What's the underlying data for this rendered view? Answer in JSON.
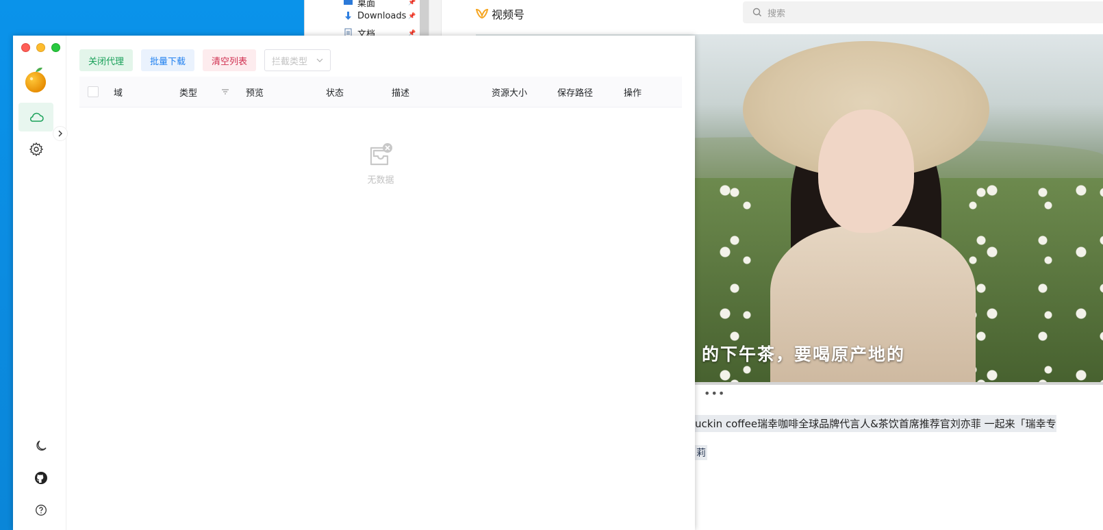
{
  "explorer": {
    "items": [
      {
        "label": "桌面",
        "icon": "desktop-icon"
      },
      {
        "label": "Downloads",
        "icon": "download-arrow-icon"
      },
      {
        "label": "文档",
        "icon": "document-icon"
      }
    ],
    "pin_glyph": "📌"
  },
  "channels": {
    "app_name": "视频号",
    "search_placeholder": "搜索",
    "video_caption": "的下午茶，要喝原产地的",
    "more": "•••",
    "description": "uckin coffee瑞幸咖啡全球品牌代言人&茶饮首席推荐官刘亦菲 一起来「瑞幸专",
    "tag": "莉"
  },
  "app": {
    "toolbar": {
      "close_proxy": "关闭代理",
      "batch_download": "批量下载",
      "clear_list": "清空列表",
      "intercept_type_placeholder": "拦截类型"
    },
    "table": {
      "columns": [
        "域",
        "类型",
        "预览",
        "状态",
        "描述",
        "资源大小",
        "保存路径",
        "操作"
      ],
      "rows": [],
      "empty_text": "无数据"
    }
  },
  "colors": {
    "accent_green": "#18a058",
    "accent_blue": "#2080f0",
    "accent_red": "#d03050",
    "desktop_blue": "#0a8ee6"
  }
}
